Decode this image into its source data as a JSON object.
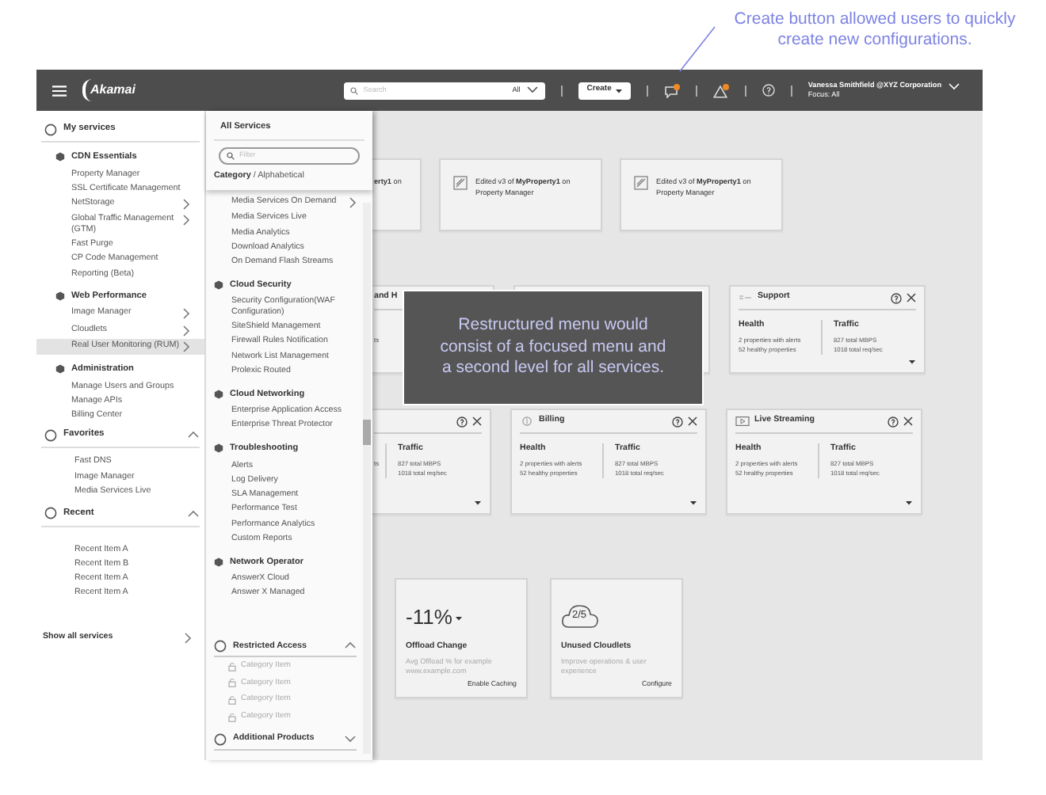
{
  "annotations": [
    {
      "kind": "callout",
      "text": "Create button allowed users to quickly create new configurations."
    },
    {
      "kind": "overlay",
      "text": "Restructured menu would consist of a focused menu and a second level for all services."
    }
  ],
  "top_bar": {
    "logo": "Akamai",
    "search": {
      "placeholder": "Search",
      "scope": "All"
    },
    "create_button": "Create",
    "user": {
      "name": "Vanessa Smithfield @XYZ Corporation",
      "focus": "Focus: All"
    }
  },
  "sidebar": {
    "sections": [
      {
        "title": "My services",
        "groups": [
          {
            "title": "CDN Essentials",
            "items": [
              {
                "label": "Property Manager",
                "submenu": false,
                "selected": false
              },
              {
                "label": "SSL Certificate Management",
                "submenu": false,
                "selected": false
              },
              {
                "label": "NetStorage",
                "submenu": true,
                "selected": false
              },
              {
                "label": "Global Traffic Management (GTM)",
                "submenu": true,
                "selected": false
              },
              {
                "label": "Fast Purge",
                "submenu": false,
                "selected": false
              },
              {
                "label": "CP Code Management",
                "submenu": false,
                "selected": false
              },
              {
                "label": "Reporting (Beta)",
                "submenu": false,
                "selected": false
              }
            ]
          },
          {
            "title": "Web Performance",
            "items": [
              {
                "label": "Image Manager",
                "submenu": true,
                "selected": false
              },
              {
                "label": "Cloudlets",
                "submenu": true,
                "selected": false
              },
              {
                "label": "Real User Monitoring (RUM)",
                "submenu": true,
                "selected": true
              }
            ]
          },
          {
            "title": "Administration",
            "items": [
              {
                "label": "Manage Users and Groups",
                "submenu": false,
                "selected": false
              },
              {
                "label": "Manage APIs",
                "submenu": false,
                "selected": false
              },
              {
                "label": "Billing Center",
                "submenu": false,
                "selected": false
              }
            ]
          }
        ]
      },
      {
        "title": "Favorites",
        "expanded": true,
        "items": [
          {
            "label": "Fast DNS",
            "selected": false
          },
          {
            "label": "Image Manager",
            "selected": false
          },
          {
            "label": "Media Services Live",
            "selected": false
          }
        ]
      },
      {
        "title": "Recent",
        "expanded": true,
        "items": [
          {
            "label": "Recent Item A",
            "selected": false
          },
          {
            "label": "Recent Item B",
            "selected": false
          },
          {
            "label": "Recent Item A",
            "selected": false
          },
          {
            "label": "Recent Item A",
            "selected": false
          }
        ]
      }
    ],
    "show_all": "Show all services"
  },
  "panel": {
    "title": "All Services",
    "filter": {
      "placeholder": "Filter"
    },
    "view_toggle": {
      "separator": "/",
      "options": [
        {
          "label": "Category",
          "selected": true
        },
        {
          "label": "Alphabetical",
          "selected": false
        }
      ]
    },
    "groups": [
      {
        "items": [
          {
            "label": "Media Services On Demand",
            "submenu": true
          },
          {
            "label": "Media Services Live"
          },
          {
            "label": "Media Analytics"
          },
          {
            "label": "Download Analytics"
          },
          {
            "label": "On Demand Flash Streams"
          }
        ]
      },
      {
        "title": "Cloud Security",
        "items": [
          {
            "label": "Security Configuration(WAF Configuration)"
          },
          {
            "label": "SiteShield Management"
          },
          {
            "label": "Firewall Rules Notification"
          },
          {
            "label": "Network List Management"
          },
          {
            "label": "Prolexic Routed"
          }
        ]
      },
      {
        "title": "Cloud Networking",
        "items": [
          {
            "label": "Enterprise Application Access"
          },
          {
            "label": "Enterprise Threat Protector"
          }
        ]
      },
      {
        "title": "Troubleshooting",
        "items": [
          {
            "label": "Alerts"
          },
          {
            "label": "Log Delivery"
          },
          {
            "label": "SLA Management"
          },
          {
            "label": "Performance Test"
          },
          {
            "label": "Performance Analytics"
          },
          {
            "label": "Custom Reports"
          }
        ]
      },
      {
        "title": "Network Operator",
        "items": [
          {
            "label": "AnswerX  Cloud"
          },
          {
            "label": "Answer X Managed"
          }
        ]
      }
    ],
    "footer_sections": [
      {
        "title": "Restricted Access",
        "expanded": true,
        "items": [
          {
            "label": "Category Item",
            "locked": true
          },
          {
            "label": "Category Item",
            "locked": true
          },
          {
            "label": "Category Item",
            "locked": true
          },
          {
            "label": "Category Item",
            "locked": true
          }
        ]
      },
      {
        "title": "Additional Products",
        "expanded": false
      }
    ]
  },
  "activity_cards": [
    {
      "text": "**erty1** on"
    },
    {
      "text": "Edited v3 of **MyProperty1** on",
      "subtext": "Property Manager"
    },
    {
      "text": "Edited v3 of **MyProperty1** on",
      "subtext": "Property Manager"
    }
  ],
  "service_rows": [
    [
      {
        "kind": "partial-title",
        "title": "and H",
        "health_lines": [
          "ts"
        ]
      },
      {
        "kind": "covered"
      },
      {
        "kind": "full",
        "title": "Support",
        "health": {
          "label": "Health",
          "lines": [
            "2 properties with alerts",
            "52 healthy properties"
          ]
        },
        "traffic": {
          "label": "Traffic",
          "lines": [
            "827 total MBPS",
            "1018 total req/sec"
          ]
        }
      }
    ],
    [
      {
        "kind": "partial-traffic",
        "health_lines": [
          "ts"
        ],
        "traffic": {
          "label": "Traffic",
          "lines": [
            "827 total MBPS",
            "1018 total req/sec"
          ]
        }
      },
      {
        "kind": "full",
        "title": "Billing",
        "health": {
          "label": "Health",
          "lines": [
            "2 properties with alerts",
            "52 healthy properties"
          ]
        },
        "traffic": {
          "label": "Traffic",
          "lines": [
            "827 total MBPS",
            "1018 total req/sec"
          ]
        }
      },
      {
        "kind": "full",
        "title": "Live Streaming",
        "health": {
          "label": "Health",
          "lines": [
            "2 properties with alerts",
            "52 healthy properties"
          ]
        },
        "traffic": {
          "label": "Traffic",
          "lines": [
            "827 total MBPS",
            "1018 total req/sec"
          ]
        }
      }
    ]
  ],
  "insight_cards": [
    {
      "kind": "metric",
      "value": "-11%",
      "title": "Offload Change",
      "description": "Avg Offload % for example www.example.com",
      "action": "Enable Caching"
    },
    {
      "kind": "cloud",
      "value": "2/5",
      "title": "Unused Cloudlets",
      "description": "Improve operations & user experience",
      "action": "Configure"
    }
  ]
}
